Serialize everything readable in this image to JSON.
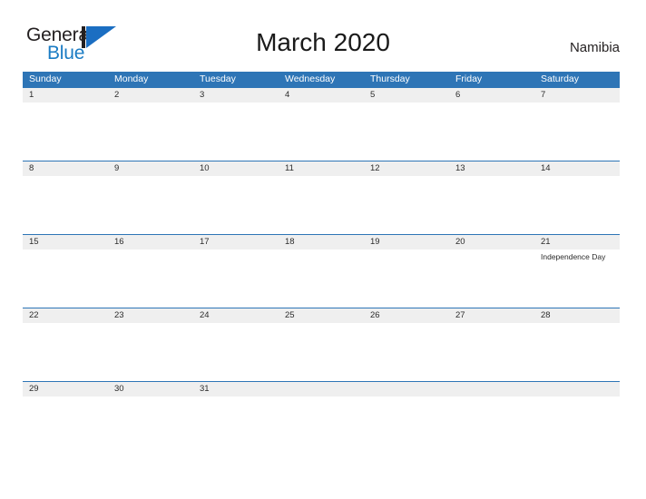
{
  "brand": {
    "name_part1": "General",
    "name_part2": "Blue",
    "mark_icon": "triangle-flag-icon",
    "color_dark": "#231f20",
    "color_blue": "#1b6ec2"
  },
  "header": {
    "title": "March 2020",
    "country": "Namibia"
  },
  "theme": {
    "header_blue": "#2e75b6",
    "date_band_gray": "#efefef",
    "row_divider_blue": "#2e75b6",
    "page_background": "#ffffff",
    "text_color": "#2b2b2b"
  },
  "calendar": {
    "weekdays": [
      "Sunday",
      "Monday",
      "Tuesday",
      "Wednesday",
      "Thursday",
      "Friday",
      "Saturday"
    ],
    "weeks": [
      [
        {
          "date": "1",
          "event": ""
        },
        {
          "date": "2",
          "event": ""
        },
        {
          "date": "3",
          "event": ""
        },
        {
          "date": "4",
          "event": ""
        },
        {
          "date": "5",
          "event": ""
        },
        {
          "date": "6",
          "event": ""
        },
        {
          "date": "7",
          "event": ""
        }
      ],
      [
        {
          "date": "8",
          "event": ""
        },
        {
          "date": "9",
          "event": ""
        },
        {
          "date": "10",
          "event": ""
        },
        {
          "date": "11",
          "event": ""
        },
        {
          "date": "12",
          "event": ""
        },
        {
          "date": "13",
          "event": ""
        },
        {
          "date": "14",
          "event": ""
        }
      ],
      [
        {
          "date": "15",
          "event": ""
        },
        {
          "date": "16",
          "event": ""
        },
        {
          "date": "17",
          "event": ""
        },
        {
          "date": "18",
          "event": ""
        },
        {
          "date": "19",
          "event": ""
        },
        {
          "date": "20",
          "event": ""
        },
        {
          "date": "21",
          "event": "Independence Day"
        }
      ],
      [
        {
          "date": "22",
          "event": ""
        },
        {
          "date": "23",
          "event": ""
        },
        {
          "date": "24",
          "event": ""
        },
        {
          "date": "25",
          "event": ""
        },
        {
          "date": "26",
          "event": ""
        },
        {
          "date": "27",
          "event": ""
        },
        {
          "date": "28",
          "event": ""
        }
      ],
      [
        {
          "date": "29",
          "event": ""
        },
        {
          "date": "30",
          "event": ""
        },
        {
          "date": "31",
          "event": ""
        },
        {
          "date": "",
          "event": ""
        },
        {
          "date": "",
          "event": ""
        },
        {
          "date": "",
          "event": ""
        },
        {
          "date": "",
          "event": ""
        }
      ]
    ]
  }
}
